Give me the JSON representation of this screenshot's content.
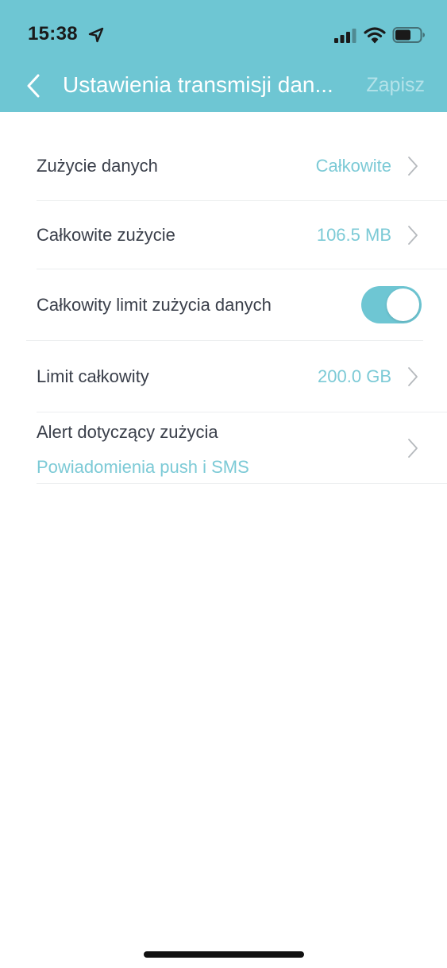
{
  "status_bar": {
    "time": "15:38"
  },
  "header": {
    "title": "Ustawienia transmisji dan...",
    "save_label": "Zapisz"
  },
  "rows": {
    "data_usage": {
      "label": "Zużycie danych",
      "value": "Całkowite"
    },
    "total_usage": {
      "label": "Całkowite zużycie",
      "value": "106.5 MB"
    },
    "total_limit_toggle": {
      "label": "Całkowity limit zużycia danych",
      "enabled": true
    },
    "total_limit": {
      "label": "Limit całkowity",
      "value": "200.0 GB"
    },
    "usage_alert": {
      "label": "Alert dotyczący zużycia",
      "sub_value": "Powiadomienia push i SMS"
    }
  },
  "colors": {
    "accent": "#6ec6d3",
    "value_text": "#7ccad6",
    "label_text": "#3a3f4a",
    "save_disabled": "#b3e2e9"
  },
  "icons": {
    "back": "chevron-left-icon",
    "row_arrow": "chevron-right-icon",
    "location": "location-arrow-icon",
    "signal": "cellular-signal-icon",
    "wifi": "wifi-icon",
    "battery": "battery-icon"
  }
}
